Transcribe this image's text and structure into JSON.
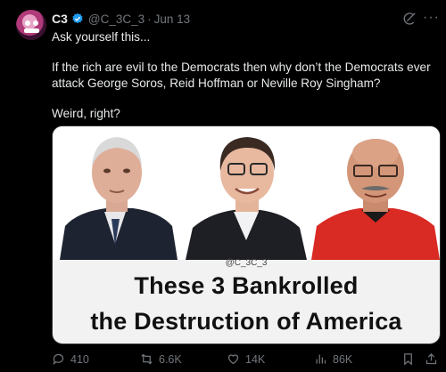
{
  "post": {
    "display_name": "C3",
    "handle": "@C_3C_3",
    "separator": "·",
    "date": "Jun 13",
    "text": {
      "line1": "Ask yourself this...",
      "line2": "If the rich are evil to the Democrats then why don’t the Democrats ever",
      "line3": "attack George Soros, Reid Hoffman or Neville Roy Singham?",
      "line4": "Weird, right?"
    },
    "media": {
      "watermark": "@C_3C_3",
      "headline_line1": "These 3 Bankrolled",
      "headline_line2": "the Destruction of America"
    },
    "actions": {
      "replies": "410",
      "reposts": "6.6K",
      "likes": "14K",
      "views": "86K"
    }
  },
  "icons": {
    "verified": "verified-badge-icon",
    "grok": "grok-icon",
    "more": "more-options-icon",
    "reply": "reply-icon",
    "repost": "repost-icon",
    "like": "heart-icon",
    "views": "views-icon",
    "bookmark": "bookmark-icon",
    "share": "share-icon"
  },
  "colors": {
    "background": "#000000",
    "text": "#e7e9ea",
    "secondary_text": "#71767b",
    "verified": "#1d9bf0"
  }
}
